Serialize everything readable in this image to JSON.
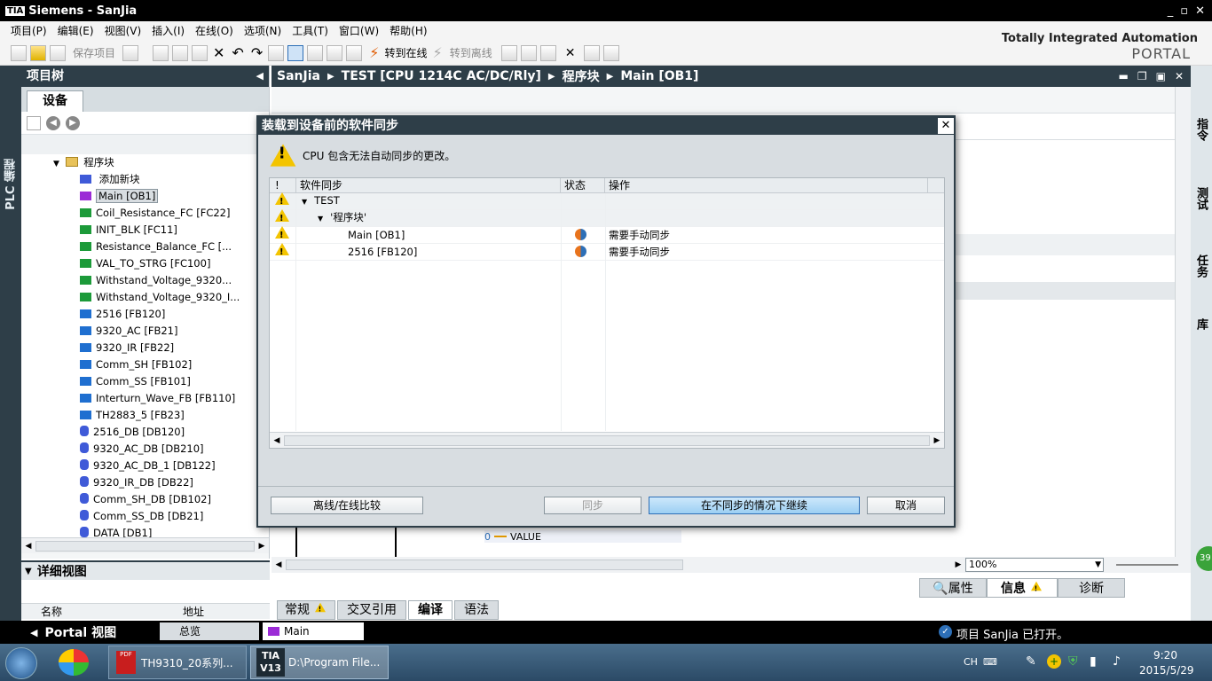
{
  "window": {
    "title": "Siemens  -  SanJia",
    "logo": "TIA"
  },
  "menu": [
    "项目(P)",
    "编辑(E)",
    "视图(V)",
    "插入(I)",
    "在线(O)",
    "选项(N)",
    "工具(T)",
    "窗口(W)",
    "帮助(H)"
  ],
  "toolbar": {
    "save_project": "保存项目",
    "go_online": "转到在线",
    "go_offline": "转到离线"
  },
  "brand": {
    "line1": "Totally Integrated Automation",
    "line2": "PORTAL"
  },
  "left_strip_label": "PLC 编程",
  "project_tree": {
    "title": "项目树",
    "tab": "设备",
    "folder": "程序块",
    "add_new": "添加新块",
    "items": [
      {
        "label": "Main [OB1]",
        "kind": "ob",
        "color": "#9b2bd6",
        "selected": true
      },
      {
        "label": "Coil_Resistance_FC [FC22]",
        "kind": "fc",
        "color": "#1c9a39"
      },
      {
        "label": "INIT_BLK [FC11]",
        "kind": "fc",
        "color": "#1c9a39"
      },
      {
        "label": "Resistance_Balance_FC [...",
        "kind": "fc",
        "color": "#1c9a39"
      },
      {
        "label": "VAL_TO_STRG [FC100]",
        "kind": "fc",
        "color": "#1c9a39"
      },
      {
        "label": "Withstand_Voltage_9320...",
        "kind": "fc",
        "color": "#1c9a39"
      },
      {
        "label": "Withstand_Voltage_9320_I...",
        "kind": "fc",
        "color": "#1c9a39"
      },
      {
        "label": "2516 [FB120]",
        "kind": "fb",
        "color": "#1f6fd0"
      },
      {
        "label": "9320_AC [FB21]",
        "kind": "fb",
        "color": "#1f6fd0"
      },
      {
        "label": "9320_IR [FB22]",
        "kind": "fb",
        "color": "#1f6fd0"
      },
      {
        "label": "Comm_SH [FB102]",
        "kind": "fb",
        "color": "#1f6fd0"
      },
      {
        "label": "Comm_SS [FB101]",
        "kind": "fb",
        "color": "#1f6fd0"
      },
      {
        "label": "Interturn_Wave_FB [FB110]",
        "kind": "fb",
        "color": "#1f6fd0"
      },
      {
        "label": "TH2883_5 [FB23]",
        "kind": "fb",
        "color": "#1f6fd0"
      },
      {
        "label": "2516_DB [DB120]",
        "kind": "db",
        "color": "#3f5ad8"
      },
      {
        "label": "9320_AC_DB [DB210]",
        "kind": "db",
        "color": "#3f5ad8"
      },
      {
        "label": "9320_AC_DB_1 [DB122]",
        "kind": "db",
        "color": "#3f5ad8"
      },
      {
        "label": "9320_IR_DB [DB22]",
        "kind": "db",
        "color": "#3f5ad8"
      },
      {
        "label": "Comm_SH_DB [DB102]",
        "kind": "db",
        "color": "#3f5ad8"
      },
      {
        "label": "Comm_SS_DB [DB21]",
        "kind": "db",
        "color": "#3f5ad8"
      },
      {
        "label": "DATA [DB1]",
        "kind": "db",
        "color": "#3f5ad8"
      }
    ]
  },
  "detail_view": {
    "title": "详细视图",
    "col_name": "名称",
    "col_address": "地址"
  },
  "editor": {
    "breadcrumb": [
      "SanJia",
      "TEST [CPU 1214C AC/DC/Rly]",
      "程序块",
      "Main [OB1]"
    ],
    "zoom": "100%",
    "value_index": "0",
    "value_label": "VALUE"
  },
  "inspector": {
    "tabs": [
      "属性",
      "信息",
      "诊断"
    ],
    "bottom_tabs": [
      "常规",
      "交叉引用",
      "编译",
      "语法"
    ]
  },
  "right_tabs": [
    "指令",
    "测试",
    "任务",
    "库"
  ],
  "dialog": {
    "title": "装载到设备前的软件同步",
    "message": "CPU 包含无法自动同步的更改。",
    "columns": {
      "flag": "!",
      "sync": "软件同步",
      "status": "状态",
      "action": "操作"
    },
    "rows": [
      {
        "indent": 0,
        "label": "TEST",
        "expander": true,
        "status": "",
        "action": ""
      },
      {
        "indent": 1,
        "label": "'程序块'",
        "expander": true,
        "status": "",
        "action": ""
      },
      {
        "indent": 2,
        "label": "Main [OB1]",
        "expander": false,
        "status": "sync-status-icon",
        "action": "需要手动同步"
      },
      {
        "indent": 2,
        "label": "2516 [FB120]",
        "expander": false,
        "status": "sync-status-icon",
        "action": "需要手动同步"
      }
    ],
    "buttons": {
      "compare": "离线/在线比较",
      "sync": "同步",
      "continue": "在不同步的情况下继续",
      "cancel": "取消"
    }
  },
  "statusbar": {
    "portal_view": "Portal 视图",
    "overview": "总览",
    "main_tab": "Main",
    "message": "项目 SanJia 已打开。"
  },
  "taskbar": {
    "pdf_task": "TH9310_20系列...",
    "tia_task": "D:\\Program File...",
    "tia_badge_line1": "TIA",
    "tia_badge_line2": "V13",
    "lang": "CH",
    "time": "9:20",
    "date": "2015/5/29",
    "badge": "39"
  }
}
